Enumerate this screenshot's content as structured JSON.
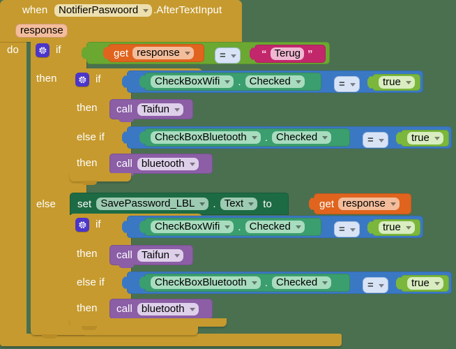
{
  "app": {
    "name": "MIT App Inventor Blocks Editor",
    "canvas_background": "#4a7050"
  },
  "palette": {
    "event_gold": "#c69a2e",
    "control_gold": "#c69a2e",
    "logic_green": "#6aa832",
    "control_blue": "#3b78c4",
    "component_getter_green": "#3b9e6e",
    "variable_orange": "#e0641e",
    "text_magenta": "#c2276b",
    "true_green": "#7bb73c",
    "procedure_purple": "#8b5ea6",
    "setter_green": "#1d6b44",
    "operator_lightblue": "#b9cce8"
  },
  "event_block": {
    "when_label": "when",
    "component": "NotifierPaswoord",
    "event_name": ".AfterTextInput",
    "parameter": "response",
    "do_label": "do"
  },
  "outer_if": {
    "if_label": "if",
    "then_label": "then",
    "else_label": "else",
    "gear_icon": "gear-icon",
    "condition": {
      "left": {
        "get_label": "get",
        "variable": "response"
      },
      "operator": "=",
      "right": {
        "open_quote": "“",
        "text": "Terug",
        "close_quote": "”"
      }
    }
  },
  "inner_if_top": {
    "if_label": "if",
    "then_label": "then",
    "else_if_label": "else if",
    "gear_icon": "gear-icon",
    "branches": [
      {
        "condition": {
          "component": "CheckBoxWifi",
          "dot": ".",
          "property": "Checked",
          "operator": "=",
          "value": "true"
        },
        "action": {
          "call_label": "call",
          "procedure": "Taifun"
        }
      },
      {
        "condition": {
          "component": "CheckBoxBluetooth",
          "dot": ".",
          "property": "Checked",
          "operator": "=",
          "value": "true"
        },
        "action": {
          "call_label": "call",
          "procedure": "bluetooth"
        }
      }
    ]
  },
  "else_branch": {
    "setter": {
      "set_label": "set",
      "component": "SavePassword_LBL",
      "dot": ".",
      "property": "Text",
      "to_label": "to",
      "value": {
        "get_label": "get",
        "variable": "response"
      }
    }
  },
  "inner_if_bottom": {
    "if_label": "if",
    "then_label": "then",
    "else_if_label": "else if",
    "gear_icon": "gear-icon",
    "branches": [
      {
        "condition": {
          "component": "CheckBoxWifi",
          "dot": ".",
          "property": "Checked",
          "operator": "=",
          "value": "true"
        },
        "action": {
          "call_label": "call",
          "procedure": "Taifun"
        }
      },
      {
        "condition": {
          "component": "CheckBoxBluetooth",
          "dot": ".",
          "property": "Checked",
          "operator": "=",
          "value": "true"
        },
        "action": {
          "call_label": "call",
          "procedure": "bluetooth"
        }
      }
    ]
  }
}
